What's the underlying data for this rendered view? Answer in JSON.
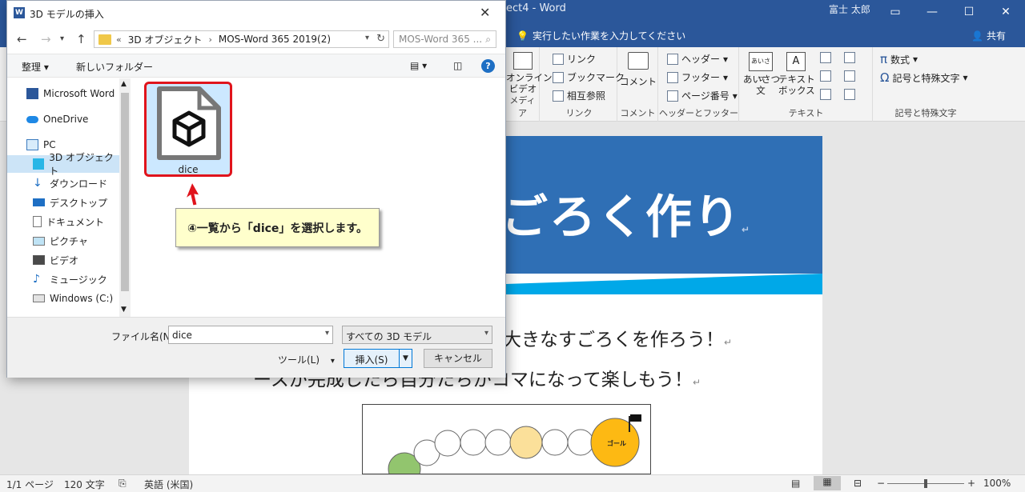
{
  "word": {
    "title": "ect4  -  Word",
    "user": "富士 太郎",
    "tell_me": "実行したい作業を入力してください",
    "share": "共有",
    "ribbon": {
      "online_video": "オンライン\nビデオ",
      "group_media": "メディア",
      "link": "リンク",
      "bookmark": "ブックマーク",
      "cross_ref": "相互参照",
      "group_links": "リンク",
      "comment": "コメント",
      "group_comments": "コメント",
      "header": "ヘッダー",
      "footer": "フッター",
      "page_number": "ページ番号",
      "group_header_footer": "ヘッダーとフッター",
      "greeting": "あいさつ\n文",
      "textbox": "テキスト\nボックス",
      "greeting_icon": "あいさつ",
      "group_text": "テキスト",
      "equation": "数式",
      "symbol": "記号と特殊文字",
      "group_symbols": "記号と特殊文字"
    },
    "doc": {
      "banner_title": "ごろく作り",
      "line1": "大きなすごろくを作ろう！",
      "line2": "ースが完成したら自分たちがコマになって楽しもう！",
      "goal_label": "ゴール"
    },
    "status": {
      "page": "1/1 ページ",
      "words": "120 文字",
      "lang": "英語 (米国)",
      "zoom": "100%"
    }
  },
  "dialog": {
    "title": "3D モデルの挿入",
    "breadcrumbs": [
      "3D オブジェクト",
      "MOS-Word 365 2019(2)"
    ],
    "search_placeholder": "MOS-Word 365 ...",
    "organize": "整理 ▾",
    "new_folder": "新しいフォルダー",
    "sidebar": [
      {
        "label": "Microsoft Word"
      },
      {
        "label": "OneDrive"
      },
      {
        "label": "PC"
      },
      {
        "label": "3D オブジェクト"
      },
      {
        "label": "ダウンロード"
      },
      {
        "label": "デスクトップ"
      },
      {
        "label": "ドキュメント"
      },
      {
        "label": "ピクチャ"
      },
      {
        "label": "ビデオ"
      },
      {
        "label": "ミュージック"
      },
      {
        "label": "Windows (C:)"
      }
    ],
    "file": {
      "name": "dice"
    },
    "callout": "④一覧から「dice」を選択します。",
    "filename_label": "ファイル名(N):",
    "filename_value": "dice",
    "filetype": "すべての 3D モデル",
    "tools": "ツール(L)",
    "insert": "挿入(S)",
    "cancel": "キャンセル"
  }
}
